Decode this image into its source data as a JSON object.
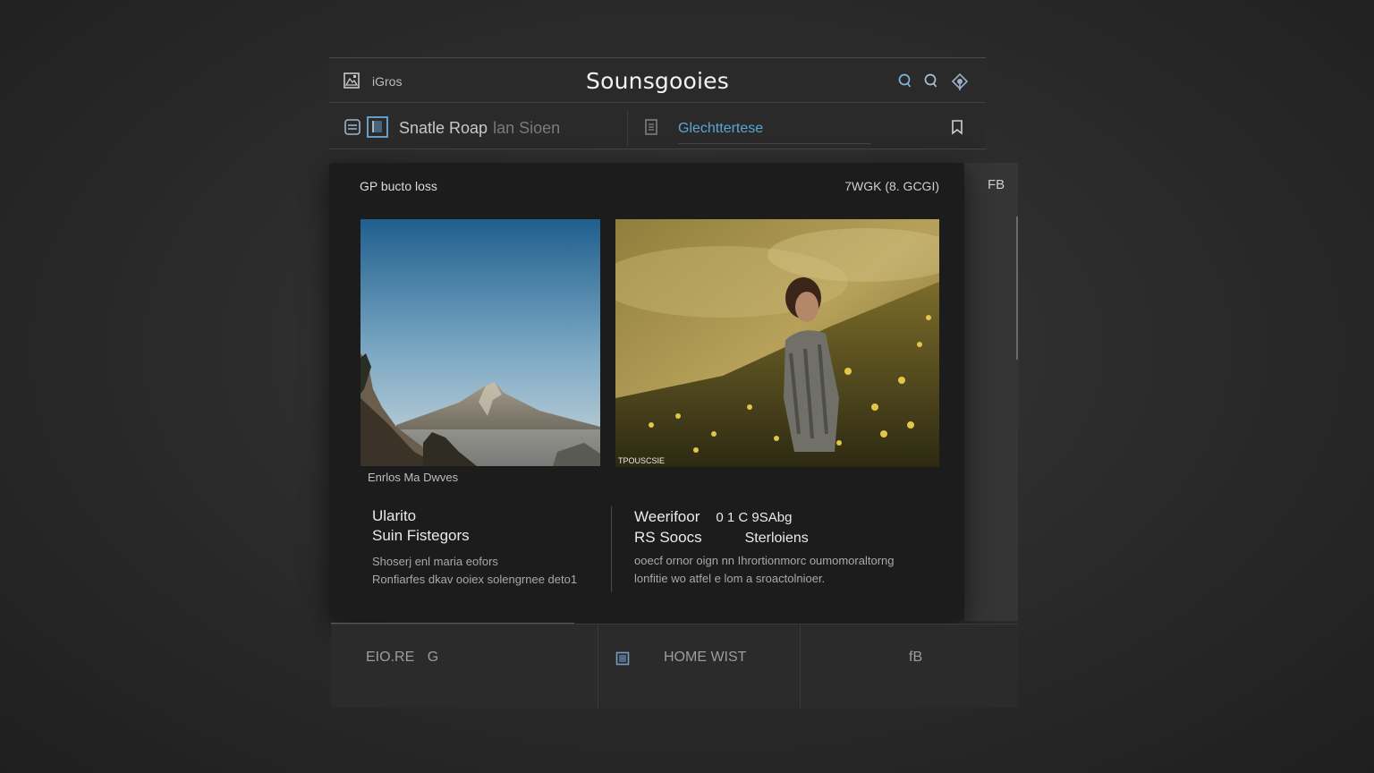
{
  "titlebar": {
    "app_label": "iGros",
    "title": "Sounsgooies",
    "icons": [
      "search-icon",
      "search-alt-icon",
      "pin-icon"
    ]
  },
  "toolbar": {
    "label_main": "Snatle Roap",
    "label_sub": "lan Sioen",
    "link": "Glechttertese"
  },
  "panel": {
    "header": "GP bucto loss",
    "meta": "7WGK (8. GCGI)",
    "image_caption": "TPOUSCSIE",
    "image_label": "Enrlos Ma Dwves",
    "card_left": {
      "title_line1": "Ularito",
      "title_line2": "Suin Fistegors",
      "text_line1": "Shoserj enl maria eofors",
      "text_line2": "Ronfiarfes dkav ooiex solengrnee deto1"
    },
    "card_right": {
      "title_line1a": "Weerifoor",
      "title_line1b": "0 1 C 9SAbg",
      "title_line2a": "RS Soocs",
      "title_line2b": "Sterloiens",
      "text_line1": "ooecf ornor oign nn Ihrortionmorc oumomoraltorng",
      "text_line2": "lonfitie wo atfel e lom a sroactolnioer."
    }
  },
  "side_strip": {
    "label": "FB"
  },
  "bottom_bar": {
    "item1": "EIO.RE",
    "item1_suffix": "G",
    "item2": "HOME WIST",
    "item3": "fB"
  },
  "colors": {
    "accent_link": "#5aa6d6",
    "panel_bg": "#1c1c1c",
    "window_bg": "#2a2a2a"
  }
}
